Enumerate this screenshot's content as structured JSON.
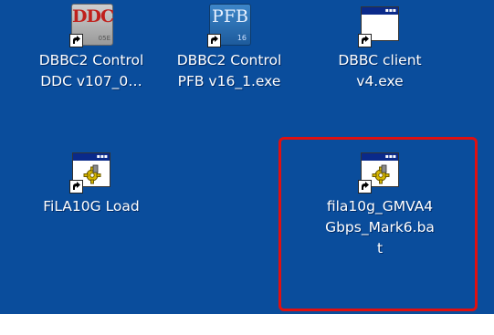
{
  "desktop": {
    "background": "#0a4d9c",
    "icons": [
      {
        "label": "DBBC2 Control\nDDC v107_0…",
        "icon": "ddc-app-icon",
        "tile_text": "DDC",
        "tile_subtext": "05E"
      },
      {
        "label": "DBBC2 Control\nPFB v16_1.exe",
        "icon": "pfb-app-icon",
        "tile_text": "PFB",
        "tile_subtext": "16"
      },
      {
        "label": "DBBC client\nv4.exe",
        "icon": "window-icon"
      },
      {
        "label": "FiLA10G Load",
        "icon": "batch-file-icon"
      },
      {
        "label": "fila10g_GMVA4\nGbps_Mark6.ba\nt",
        "icon": "batch-file-icon"
      }
    ],
    "highlight_color": "#e01010"
  }
}
